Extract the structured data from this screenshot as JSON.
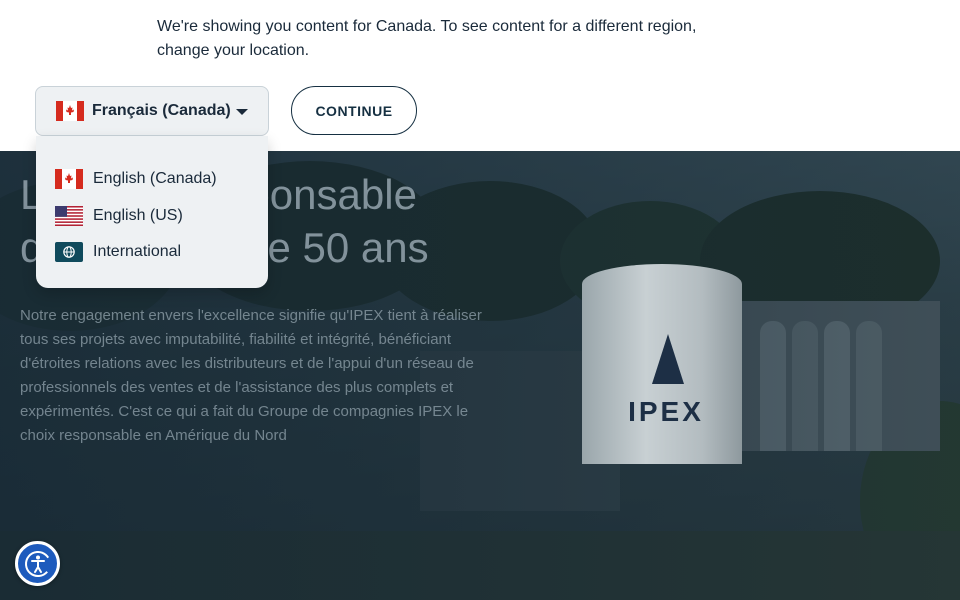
{
  "notice": {
    "line1": "We're showing you content for Canada. To see content for a different region,",
    "line2": "change your location."
  },
  "language_selector": {
    "selected_label": "Français (Canada)",
    "selected_flag": "canada-flag-icon",
    "options": [
      {
        "label": "English (Canada)",
        "icon": "canada-flag-icon"
      },
      {
        "label": "English (US)",
        "icon": "us-flag-icon"
      },
      {
        "label": "International",
        "icon": "globe-icon"
      }
    ]
  },
  "continue_button": {
    "label": "CONTINUE"
  },
  "hero": {
    "title_line1": "Le choix responsable",
    "title_line2": "depuis plus de 50 ans",
    "body": "Notre engagement envers l'excellence signifie qu'IPEX tient à réaliser tous ses projets avec imputabilité, fiabilité et intégrité, bénéficiant d'étroites relations avec les distributeurs et de l'appui d'un réseau de professionnels des ventes et de l'assistance des plus complets et expérimentés. C'est ce qui a fait du Groupe de compagnies IPEX le choix responsable en Amérique du Nord",
    "silo_brand": "IPEX"
  },
  "accessibility": {
    "icon": "accessibility-icon"
  },
  "colors": {
    "primary_navy": "#163042",
    "canada_red": "#d52b1e",
    "globe_bg": "#0f4a5c",
    "a11y_blue": "#1e5bbd",
    "dropdown_bg": "#eef1f3"
  }
}
